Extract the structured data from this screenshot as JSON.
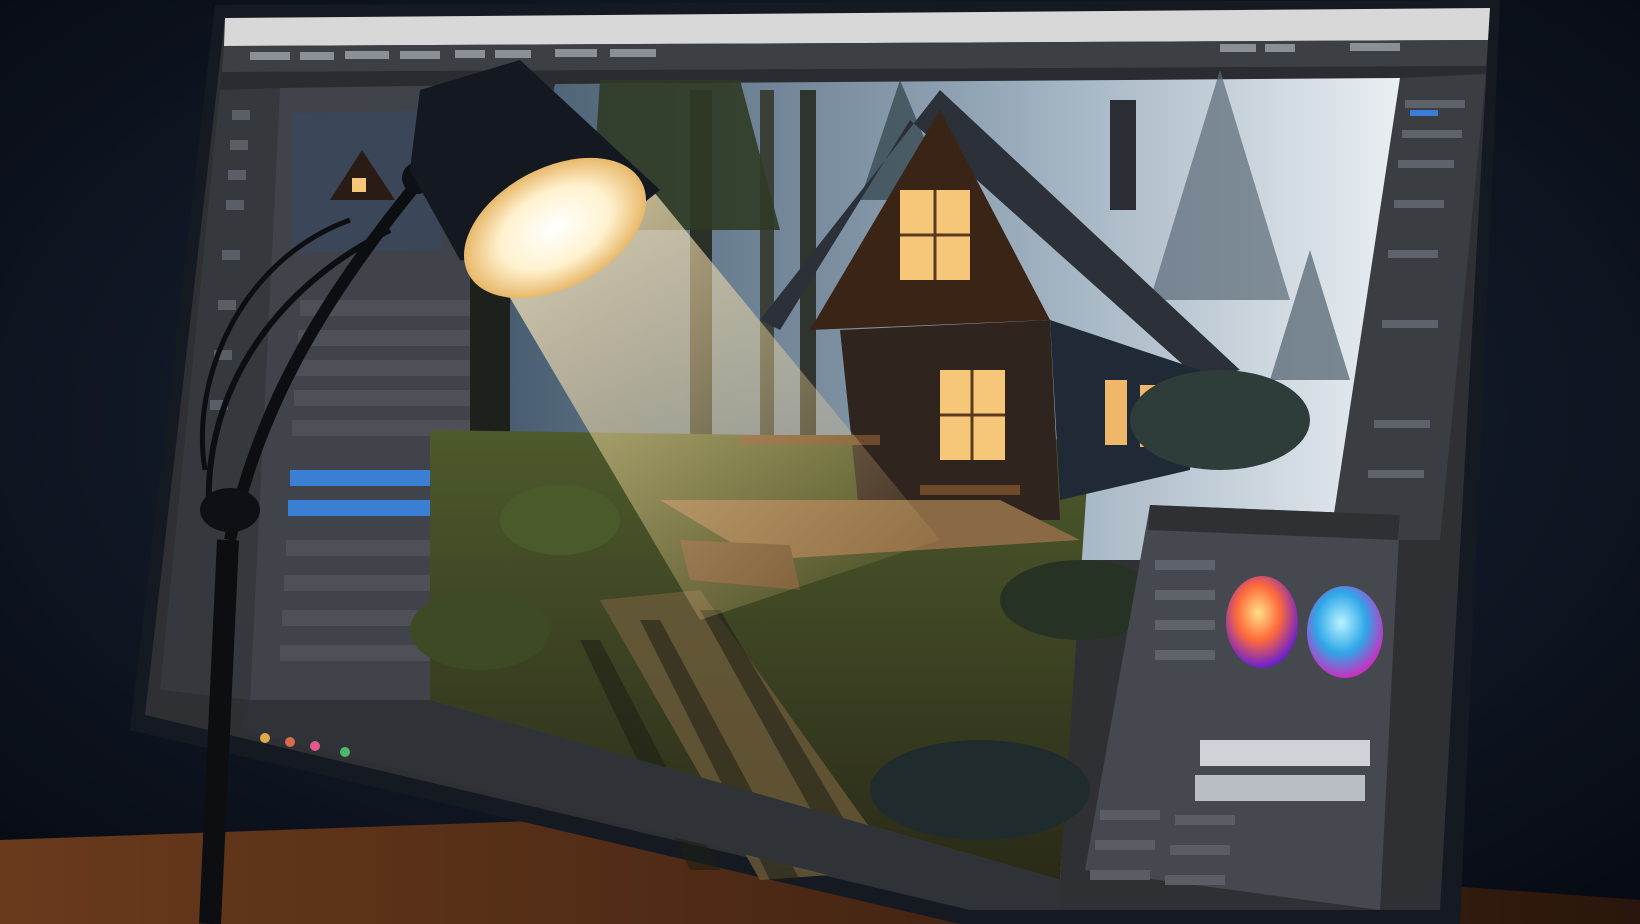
{
  "scene": {
    "kind": "photo",
    "subject": "monitor-with-image-editor",
    "foreground_object": "desk-lamp",
    "canvas_image": "forest-cabin",
    "colors": {
      "room": "#0b1220",
      "monitor_bezel": "#151a22",
      "ui_panel": "#3a3d42",
      "ui_panel_dark": "#2a2c30",
      "title_bar": "#d8d8d8",
      "selection": "#3b7fd4",
      "lamp_glow": "#fff2cf",
      "cabin_window": "#f6c779",
      "forest": "#2e3d2c"
    }
  }
}
